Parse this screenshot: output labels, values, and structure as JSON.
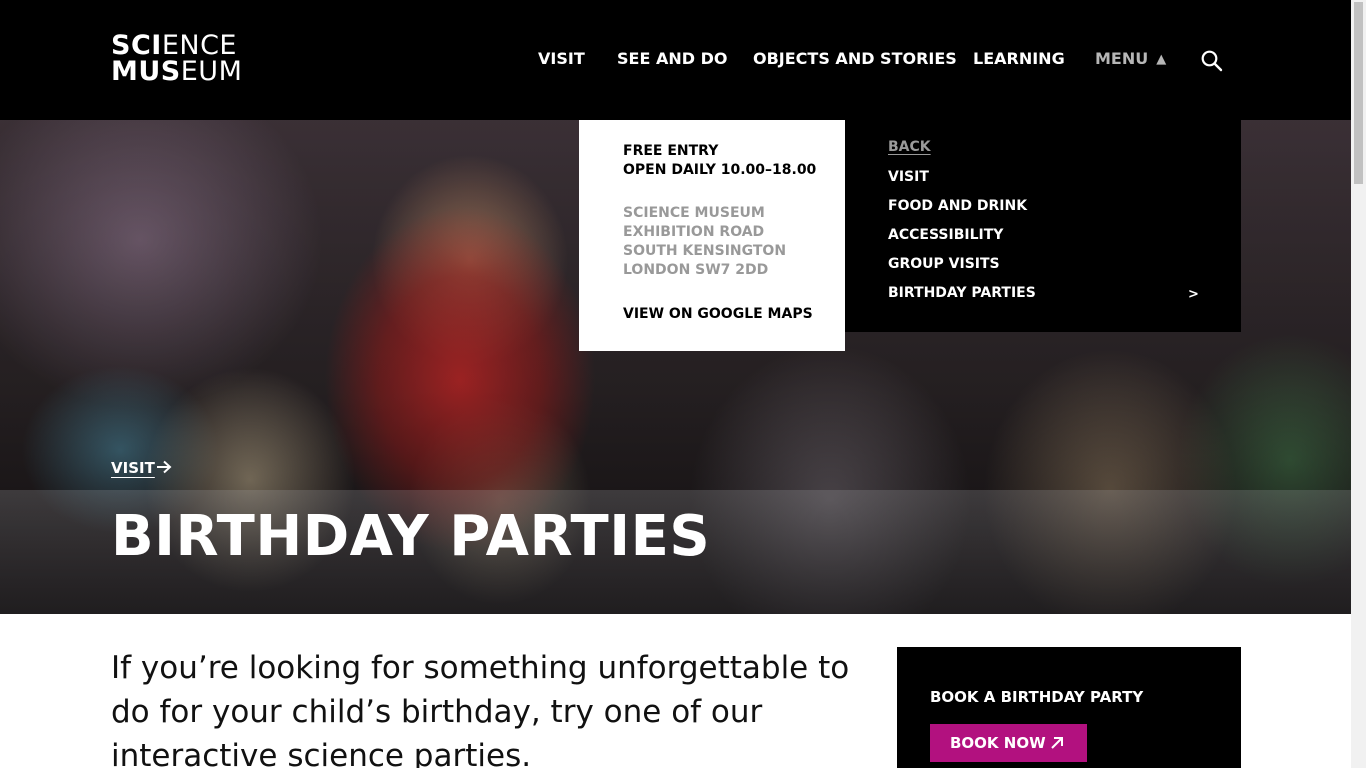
{
  "header": {
    "logo": {
      "line1_bold": "SCI",
      "line1_light": "ENCE",
      "line2_bold": "MUS",
      "line2_light": "EUM"
    },
    "nav": [
      {
        "label": "VISIT"
      },
      {
        "label": "SEE AND DO"
      },
      {
        "label": "OBJECTS AND STORIES"
      },
      {
        "label": "LEARNING"
      },
      {
        "label": "MENU"
      }
    ],
    "menu_arrow": "▲",
    "search_icon": "search-icon"
  },
  "hero": {
    "breadcrumb": "VISIT",
    "breadcrumb_icon": "arrow-right-icon",
    "title": "BIRTHDAY PARTIES"
  },
  "info_panel": {
    "entry": "FREE ENTRY",
    "hours": "OPEN DAILY 10.00–18.00",
    "address": [
      "SCIENCE MUSEUM",
      "EXHIBITION ROAD",
      "SOUTH KENSINGTON",
      "LONDON SW7 2DD"
    ],
    "maps_link": "VIEW ON GOOGLE MAPS"
  },
  "menu_panel": {
    "back": "BACK",
    "items": [
      {
        "label": "VISIT"
      },
      {
        "label": "FOOD AND DRINK"
      },
      {
        "label": "ACCESSIBILITY"
      },
      {
        "label": "GROUP VISITS"
      },
      {
        "label": "BIRTHDAY PARTIES"
      }
    ],
    "submenu_indicator": ">"
  },
  "main": {
    "intro": "If you’re looking for something unforgettable to do for your child’s birthday, try one of our interactive science parties."
  },
  "booking": {
    "heading": "BOOK A BIRTHDAY PARTY",
    "button": "BOOK NOW",
    "button_icon": "external-arrow-icon",
    "accent": "#b2117f"
  }
}
